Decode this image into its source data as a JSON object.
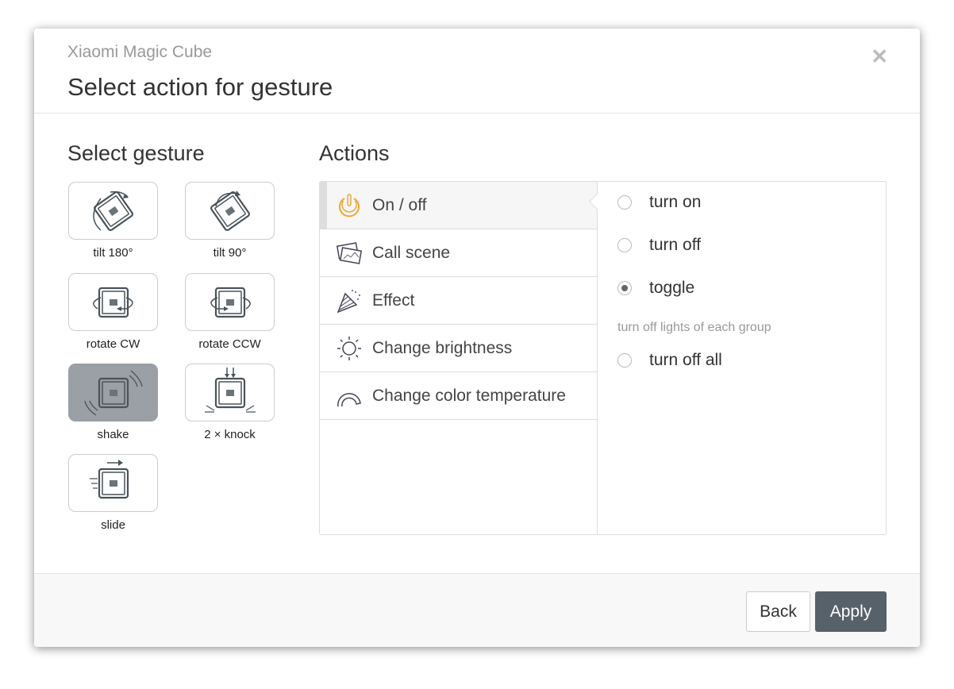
{
  "header": {
    "subtitle": "Xiaomi Magic Cube",
    "title": "Select action for gesture",
    "close_icon": "close-icon"
  },
  "gestures": {
    "heading": "Select gesture",
    "selected": "shake",
    "items": [
      {
        "label": "tilt 180°",
        "icon": "tilt-180-icon"
      },
      {
        "label": "tilt 90°",
        "icon": "tilt-90-icon"
      },
      {
        "label": "rotate CW",
        "icon": "rotate-cw-icon"
      },
      {
        "label": "rotate CCW",
        "icon": "rotate-ccw-icon"
      },
      {
        "label": "shake",
        "icon": "shake-icon"
      },
      {
        "label": "2 × knock",
        "icon": "knock-icon"
      },
      {
        "label": "slide",
        "icon": "slide-icon"
      }
    ]
  },
  "actions": {
    "heading": "Actions",
    "selected": "On / off",
    "items": [
      {
        "label": "On / off",
        "icon": "power-icon"
      },
      {
        "label": "Call scene",
        "icon": "scene-icon"
      },
      {
        "label": "Effect",
        "icon": "party-popper-icon"
      },
      {
        "label": "Change brightness",
        "icon": "sun-icon"
      },
      {
        "label": "Change color temperature",
        "icon": "arc-icon"
      }
    ]
  },
  "options": {
    "items": [
      {
        "label": "turn on",
        "checked": false
      },
      {
        "label": "turn off",
        "checked": false
      },
      {
        "label": "toggle",
        "checked": true
      }
    ],
    "group_label": "turn off lights of each group",
    "group_item": {
      "label": "turn off all",
      "checked": false
    }
  },
  "footer": {
    "back": "Back",
    "apply": "Apply"
  },
  "colors": {
    "accent_power": "#f0a830",
    "apply_bg": "#56616a",
    "selected_tile": "#9aa0a5"
  }
}
